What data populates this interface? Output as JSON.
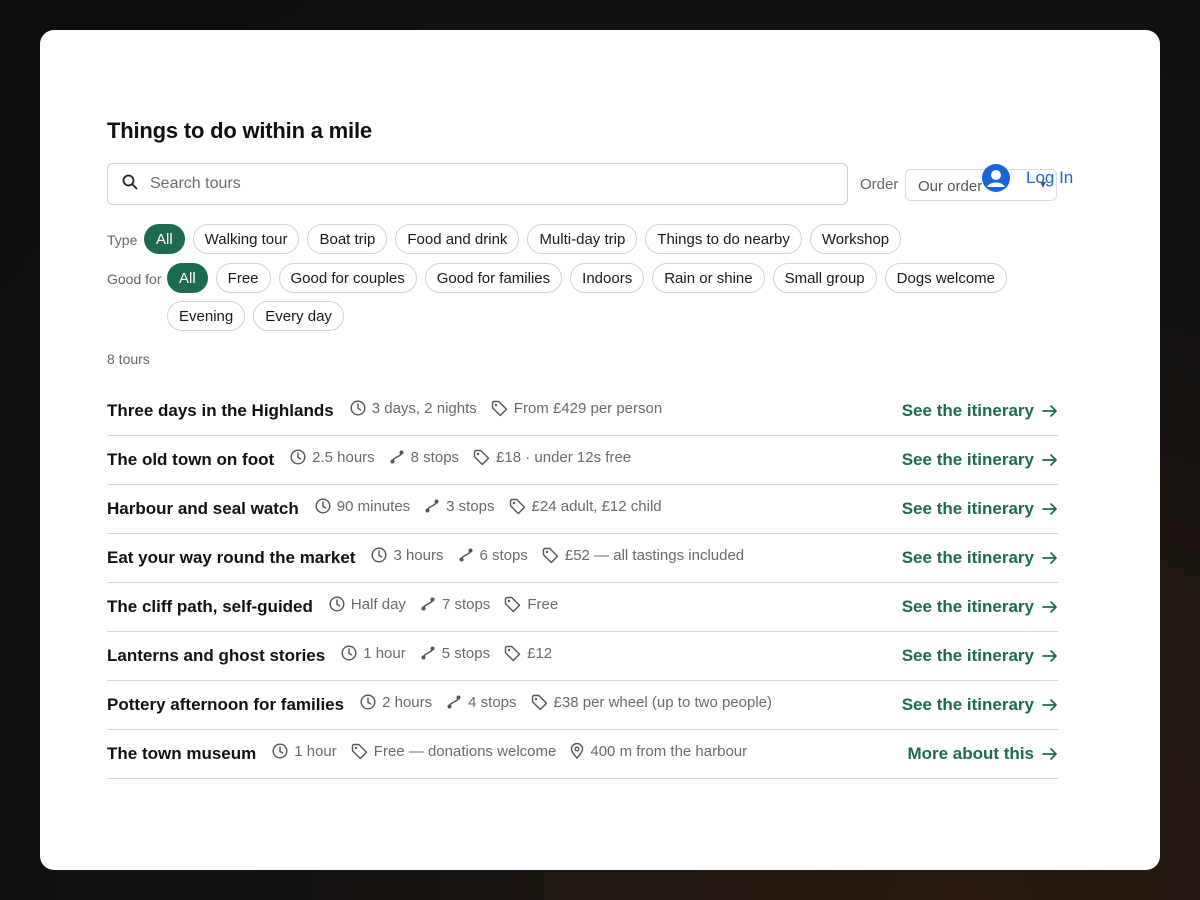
{
  "page": {
    "title": "Things to do within a mile"
  },
  "auth": {
    "login_label": "Log In"
  },
  "search": {
    "placeholder": "Search tours"
  },
  "order": {
    "label": "Order",
    "selected": "Our order"
  },
  "filters": {
    "type_label": "Type",
    "type_chips": [
      "All",
      "Walking tour",
      "Boat trip",
      "Food and drink",
      "Multi-day trip",
      "Things to do nearby",
      "Workshop"
    ],
    "good_for_label": "Good for",
    "good_for_chips_row1": [
      "All",
      "Free",
      "Good for couples",
      "Good for families",
      "Indoors",
      "Rain or shine",
      "Small group",
      "Dogs welcome"
    ],
    "good_for_chips_row2": [
      "Evening",
      "Every day"
    ]
  },
  "results": {
    "count_label": "8 tours",
    "tours": [
      {
        "name": "Three days in the Highlands",
        "duration": "3 days, 2 nights",
        "stops": "",
        "price": "From £429 per person",
        "location": "",
        "link": "See the itinerary"
      },
      {
        "name": "The old town on foot",
        "duration": "2.5 hours",
        "stops": "8 stops",
        "price": "£18 · under 12s free",
        "location": "",
        "link": "See the itinerary"
      },
      {
        "name": "Harbour and seal watch",
        "duration": "90 minutes",
        "stops": "3 stops",
        "price": "£24 adult, £12 child",
        "location": "",
        "link": "See the itinerary"
      },
      {
        "name": "Eat your way round the market",
        "duration": "3 hours",
        "stops": "6 stops",
        "price": "£52 — all tastings included",
        "location": "",
        "link": "See the itinerary"
      },
      {
        "name": "The cliff path, self-guided",
        "duration": "Half day",
        "stops": "7 stops",
        "price": "Free",
        "location": "",
        "link": "See the itinerary"
      },
      {
        "name": "Lanterns and ghost stories",
        "duration": "1 hour",
        "stops": "5 stops",
        "price": "£12",
        "location": "",
        "link": "See the itinerary"
      },
      {
        "name": "Pottery afternoon for families",
        "duration": "2 hours",
        "stops": "4 stops",
        "price": "£38 per wheel (up to two people)",
        "location": "",
        "link": "See the itinerary"
      },
      {
        "name": "The town museum",
        "duration": "1 hour",
        "stops": "",
        "price": "Free — donations welcome",
        "location": "400 m from the harbour",
        "link": "More about this"
      }
    ]
  },
  "colors": {
    "accent": "#1d6a53",
    "link_blue": "#1a66d8",
    "muted_text": "#6a6a6a",
    "border": "#d6d6d6"
  },
  "icons": {
    "search": "search-icon",
    "duration": "clock-icon",
    "stops": "route-icon",
    "price": "tag-icon",
    "location": "map-pin-icon",
    "link": "arrow-right-icon",
    "user": "user-avatar-icon"
  }
}
